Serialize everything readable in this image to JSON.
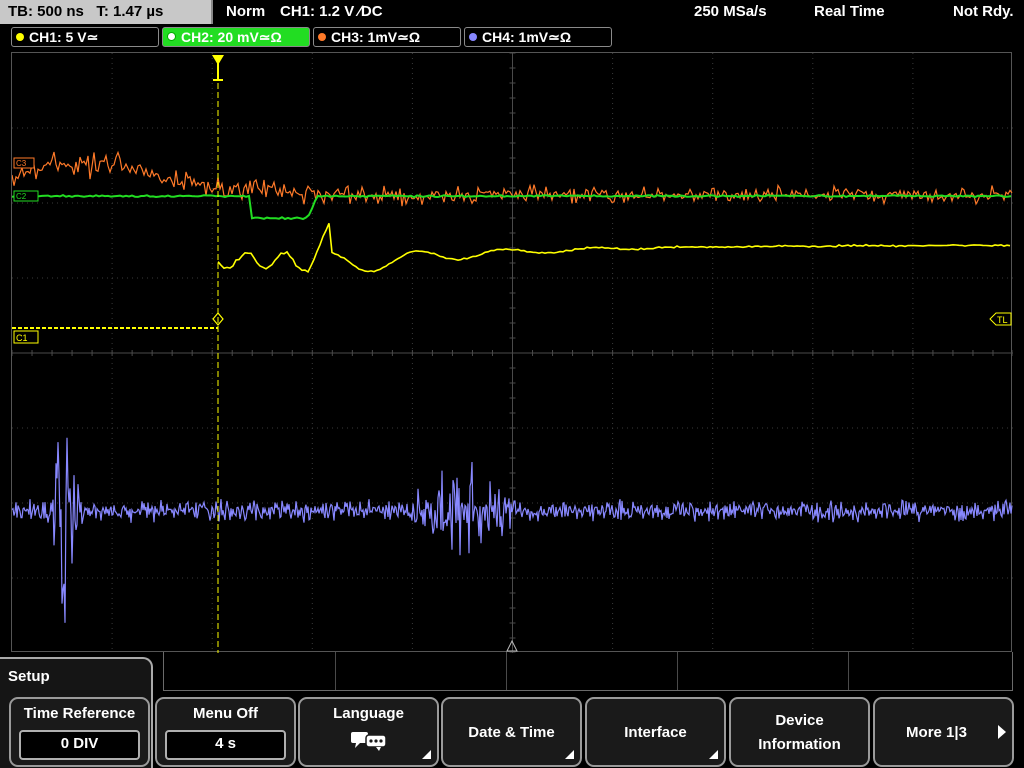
{
  "status_bar": {
    "timebase": "TB: 500 ns   T: 1.47 µs",
    "mode": "Norm",
    "trigger": "CH1: 1.2 V ∕DC",
    "sample_rate": "250 MSa/s",
    "acq_mode": "Real Time",
    "status": "Not Rdy."
  },
  "channels": [
    {
      "label": "CH1: 5 V≃",
      "color": "#ffff00"
    },
    {
      "label": "CH2: 20 mV≃Ω",
      "color": "#22dd22"
    },
    {
      "label": "CH3: 1mV≃Ω",
      "color": "#ff7a29"
    },
    {
      "label": "CH4: 1mV≃Ω",
      "color": "#8888ff"
    }
  ],
  "markers": {
    "ch1": "C1",
    "ch2": "C2",
    "ch3": "C3",
    "trigger_level": "TL"
  },
  "menu": {
    "title": "Setup",
    "softkeys": [
      {
        "label": "Time Reference",
        "value": "0 DIV"
      },
      {
        "label": "Menu Off",
        "value": "4 s"
      },
      {
        "label": "Language",
        "icon": "language-chat-icon"
      },
      {
        "label": "Date & Time"
      },
      {
        "label": "Interface"
      },
      {
        "label_line1": "Device",
        "label_line2": "Information"
      },
      {
        "label": "More 1|3"
      }
    ]
  },
  "colors": {
    "ch1": "#ffff00",
    "ch2": "#22dd22",
    "ch3": "#ff7a29",
    "ch4": "#8888ff",
    "grid": "#3a3a3a"
  }
}
